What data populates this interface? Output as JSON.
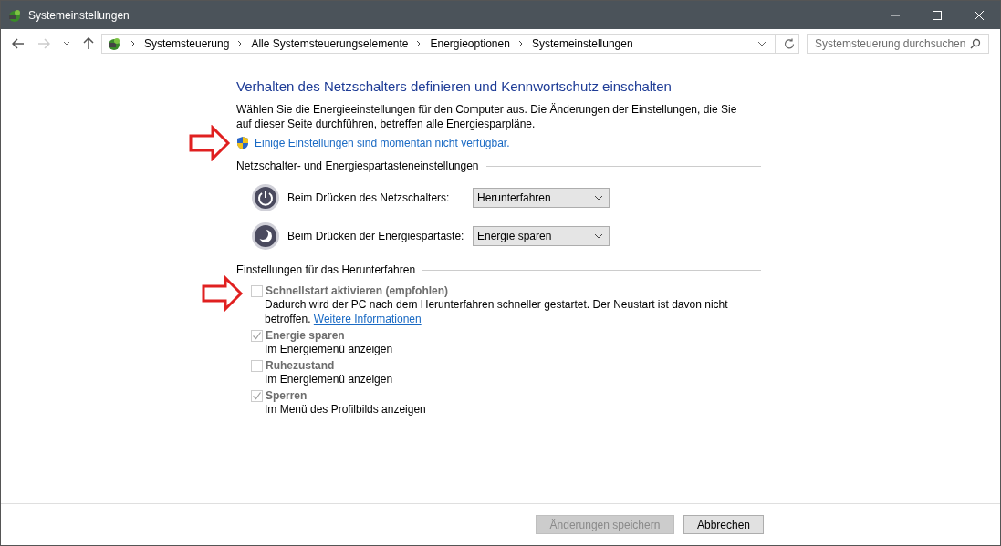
{
  "window": {
    "title": "Systemeinstellungen",
    "controls": [
      {
        "kind": "minimize"
      },
      {
        "kind": "maximize"
      },
      {
        "kind": "close"
      }
    ]
  },
  "nav": {
    "back_disabled": false,
    "forward_disabled": true,
    "breadcrumbs": [
      "Systemsteuerung",
      "Alle Systemsteuerungselemente",
      "Energieoptionen",
      "Systemeinstellungen"
    ],
    "search": {
      "placeholder": "Systemsteuerung durchsuchen"
    }
  },
  "heading": "Verhalten des Netzschalters definieren und Kennwortschutz einschalten",
  "intro": "Wählen Sie die Energieeinstellungen für den Computer aus. Die Änderungen der Einstellungen, die Sie auf dieser Seite durchführen, betreffen alle Energiesparpläne.",
  "admin_link": "Einige Einstellungen sind momentan nicht verfügbar.",
  "button_section": {
    "title": "Netzschalter- und Energiespartasteneinstellungen",
    "rows": [
      {
        "kind": "power",
        "label": "Beim Drücken des Netzschalters:",
        "value": "Herunterfahren"
      },
      {
        "kind": "sleep",
        "label": "Beim Drücken der Energiespartaste:",
        "value": "Energie sparen"
      }
    ]
  },
  "shutdown_section": {
    "title": "Einstellungen für das Herunterfahren",
    "options": [
      {
        "label": "Schnellstart aktivieren (empfohlen)",
        "checked": false,
        "disabled": true,
        "description": "Dadurch wird der PC nach dem Herunterfahren schneller gestartet. Der Neustart ist davon nicht betroffen.",
        "link": "Weitere Informationen"
      },
      {
        "label": "Energie sparen",
        "checked": true,
        "disabled": true,
        "description": "Im Energiemenü anzeigen"
      },
      {
        "label": "Ruhezustand",
        "checked": false,
        "disabled": true,
        "description": "Im Energiemenü anzeigen"
      },
      {
        "label": "Sperren",
        "checked": true,
        "disabled": true,
        "description": "Im Menü des Profilbilds anzeigen"
      }
    ]
  },
  "footer": {
    "buttons": [
      {
        "label": "Änderungen speichern",
        "disabled": true
      },
      {
        "label": "Abbrechen",
        "disabled": false
      }
    ]
  }
}
